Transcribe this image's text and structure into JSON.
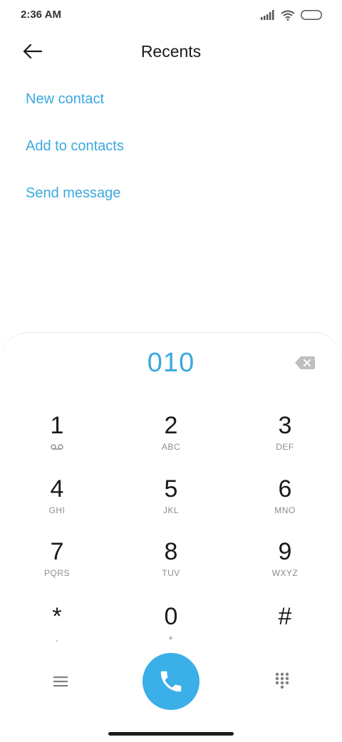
{
  "status": {
    "time": "2:36 AM"
  },
  "header": {
    "title": "Recents"
  },
  "actions": [
    "New contact",
    "Add to contacts",
    "Send message"
  ],
  "dialer": {
    "number": "010",
    "keys": [
      {
        "digit": "1",
        "letters": ""
      },
      {
        "digit": "2",
        "letters": "ABC"
      },
      {
        "digit": "3",
        "letters": "DEF"
      },
      {
        "digit": "4",
        "letters": "GHI"
      },
      {
        "digit": "5",
        "letters": "JKL"
      },
      {
        "digit": "6",
        "letters": "MNO"
      },
      {
        "digit": "7",
        "letters": "PQRS"
      },
      {
        "digit": "8",
        "letters": "TUV"
      },
      {
        "digit": "9",
        "letters": "WXYZ"
      },
      {
        "digit": "*",
        "letters": ","
      },
      {
        "digit": "0",
        "letters": "+"
      },
      {
        "digit": "#",
        "letters": ""
      }
    ]
  },
  "colors": {
    "accent": "#3aa9de",
    "call_button": "#3aafe8"
  }
}
